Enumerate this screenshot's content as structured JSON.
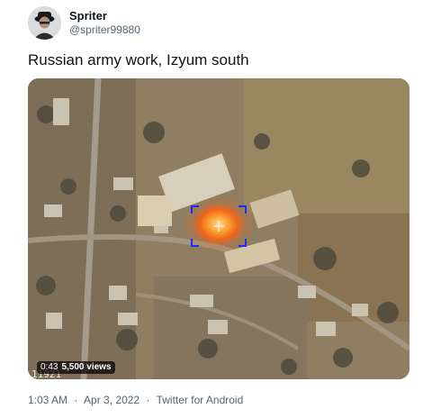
{
  "author": {
    "display_name": "Spriter",
    "handle": "@spriter99880",
    "avatar_icon": "avatar-portrait-icon"
  },
  "tweet": {
    "text": "Russian army work, Izyum south"
  },
  "media": {
    "type": "video",
    "duration": "0:43",
    "views": "5,500 views",
    "frame_code": "11921",
    "target_reticle_icon": "crosshair-reticle-icon"
  },
  "meta": {
    "time": "1:03 AM",
    "date": "Apr 3, 2022",
    "separator": "·",
    "client": "Twitter for Android"
  },
  "colors": {
    "text_primary": "#0f1419",
    "text_secondary": "#536471",
    "reticle": "#1d2cff",
    "explosion": "#ff8a1f"
  }
}
